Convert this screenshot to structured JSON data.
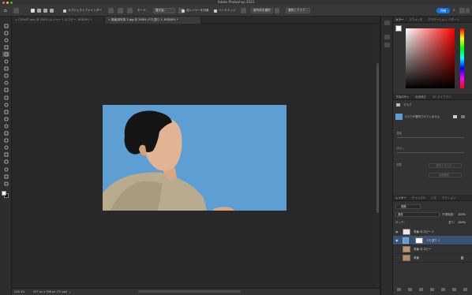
{
  "app": {
    "title": "Adobe Photoshop 2023"
  },
  "options_bar": {
    "auto_select_label": "オブジェクトファインダー",
    "mode_label": "モード:",
    "mode_value": "露光量:",
    "sample_all_label": "全レイヤーを対象",
    "hard_edge_label": "ハードエッジ",
    "select_subject_label": "被写体を選択",
    "select_mask_label": "選択とマスク...",
    "share_label": "共有"
  },
  "tabs": [
    {
      "label": "C05d0T.png @ 100% (レイヤー 1 のコピー, RGB/8*) *"
    },
    {
      "label": "取組用写真 3.jpg @ 248% (べた塗り 1, RGB/8*) *"
    }
  ],
  "status": {
    "zoom": "248.4%",
    "doc_info": "507 px x 306 px (72 ppi)"
  },
  "color_panel": {
    "tabs": [
      "カラー",
      "スウォッチ",
      "グラデーション",
      "パターン"
    ]
  },
  "properties_panel": {
    "tabs": [
      "プロパティ",
      "色調補正",
      "CC ライブラリ"
    ],
    "section": "マスク",
    "no_mask": "マスクが選択されていません",
    "density_label": "濃度",
    "feather_label": "ぼかし",
    "refine_label": "調整",
    "select_mask_btn": "選択とマスク...",
    "color_range_btn": "色域指定..."
  },
  "layers_panel": {
    "tabs": [
      "レイヤー",
      "チャンネル",
      "パス",
      "アクション"
    ],
    "filter_label": "種類",
    "blend_mode": "通常",
    "opacity_label": "不透明度:",
    "opacity_value": "100%",
    "lock_label": "ロック:",
    "fill_label": "塗り:",
    "fill_value": "100%",
    "layers": [
      {
        "name": "背景 のコピー 2"
      },
      {
        "name": "べた塗り 1"
      },
      {
        "name": "背景 のコピー"
      },
      {
        "name": "背景"
      }
    ]
  },
  "colors": {
    "accent": "#1473e6",
    "canvas_blue": "#5d9ed3",
    "selected_layer": "#3b5274"
  }
}
